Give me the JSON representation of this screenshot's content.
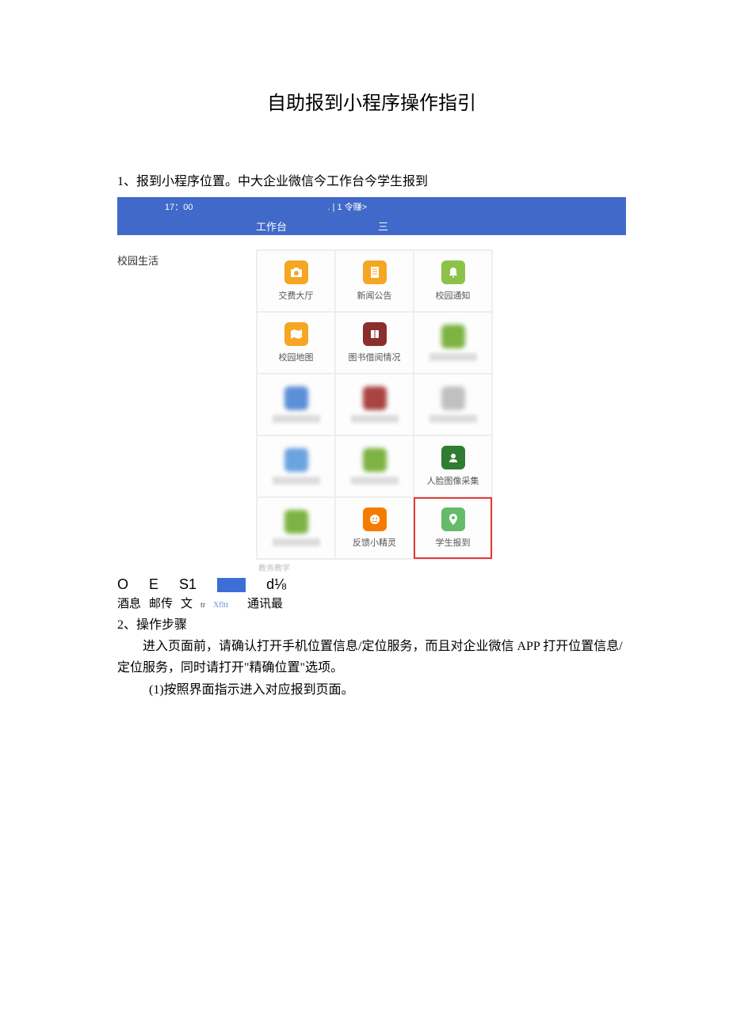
{
  "title": "自助报到小程序操作指引",
  "section1": "1、报到小程序位置。中大企业微信今工作台今学生报到",
  "status": {
    "time": "17：00",
    "center": ". | 1 令赚>"
  },
  "navbar": {
    "title": "工作台",
    "menu": "三"
  },
  "sidebar_label": "校园生活",
  "grid": [
    {
      "label": "交费大厅",
      "icon": "orange-camera"
    },
    {
      "label": "新闻公告",
      "icon": "orange-doc"
    },
    {
      "label": "校园通知",
      "icon": "green-bell"
    },
    {
      "label": "校园地图",
      "icon": "orange-map"
    },
    {
      "label": "图书借阅情况",
      "icon": "red-book"
    },
    {
      "label": "",
      "icon": "blur-green"
    },
    {
      "label": "",
      "icon": "blur-blue"
    },
    {
      "label": "",
      "icon": "blur-red"
    },
    {
      "label": "",
      "icon": "blur-gray"
    },
    {
      "label": "",
      "icon": "blur-blue2"
    },
    {
      "label": "",
      "icon": "blur-green2"
    },
    {
      "label": "人脸图像采集",
      "icon": "green-person"
    },
    {
      "label": "",
      "icon": "blur-green3"
    },
    {
      "label": "反馈小精灵",
      "icon": "orange-face"
    },
    {
      "label": "学生报到",
      "icon": "green-pin",
      "highlight": true
    }
  ],
  "footer_label": "教务教学",
  "nav_row1": [
    "O",
    "E",
    "S1",
    "",
    "d⅛"
  ],
  "nav_row2": {
    "a": "酒息",
    "b": "邮传",
    "c": "文",
    "d": "tr",
    "e": "Xfltt",
    "f": "通讯最"
  },
  "section2": {
    "head": "2、操作步骤",
    "p1": "进入页面前，请确认打开手机位置信息/定位服务，而且对企业微信 APP 打开位置信息/定位服务，同时请打开\"精确位置\"选项。",
    "p2": "(1)按照界面指示进入对应报到页面。"
  }
}
